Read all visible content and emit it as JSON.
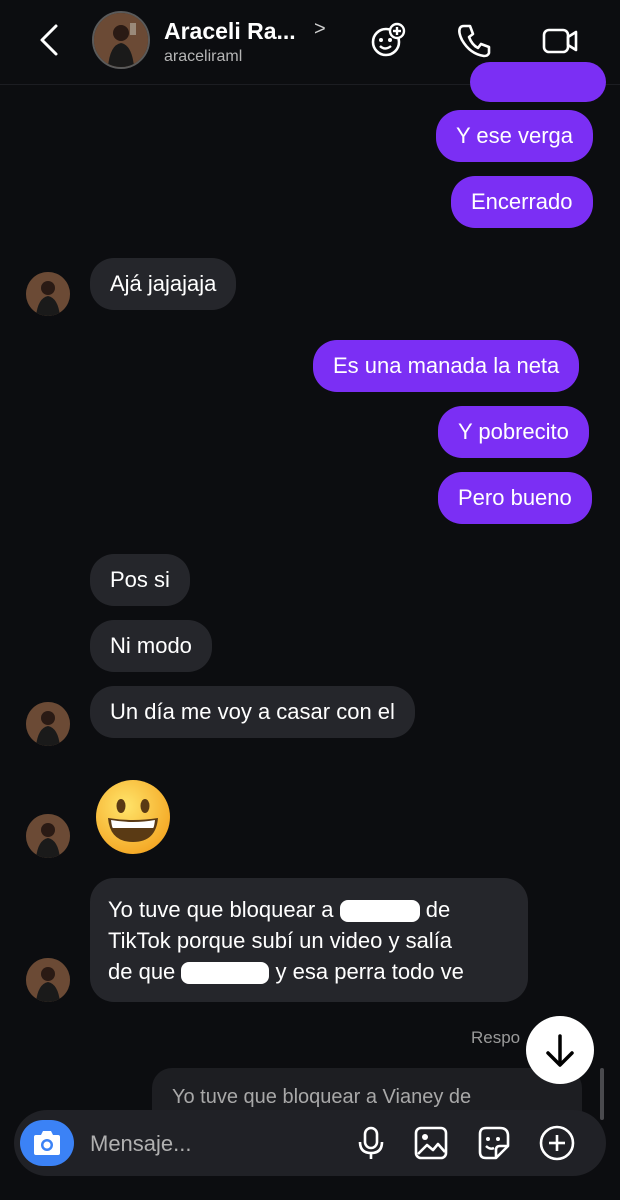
{
  "header": {
    "name": "Araceli Ra...",
    "username": "araceliraml",
    "chevron": ">",
    "icons": [
      "back-icon",
      "effects-icon",
      "phone-icon",
      "video-icon"
    ]
  },
  "messages": {
    "m1": "Y ese verga",
    "m2": "Encerrado",
    "m3": "Ajá jajajaja",
    "m4": "Es una manada la neta",
    "m5": "Y pobrecito",
    "m6": "Pero bueno",
    "m7": "Pos si",
    "m8": "Ni modo",
    "m9": "Un día me voy a casar con el",
    "emoji": "😀",
    "m11_a": "Yo tuve que bloquear a",
    "m11_b": "de",
    "m11_c": "TikTok porque subí un video y salía",
    "m11_d": "de que",
    "m11_e": "y esa perra todo ve"
  },
  "reply": {
    "label": "Respo",
    "quoted": "Yo tuve que bloquear a Vianey de"
  },
  "composer": {
    "placeholder": "Mensaje...",
    "icons": [
      "camera-icon",
      "microphone-icon",
      "gallery-icon",
      "sticker-icon",
      "plus-icon"
    ]
  },
  "colors": {
    "outgoing": "#7b2ff4",
    "incoming": "#25262b",
    "background": "#0c0d10",
    "camera": "#3b82f6"
  }
}
